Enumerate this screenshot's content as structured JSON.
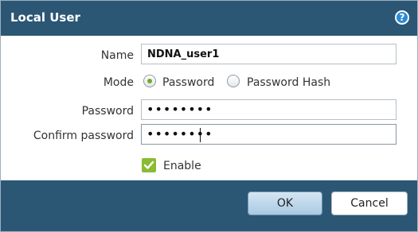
{
  "dialog": {
    "title": "Local User",
    "help_icon_glyph": "?"
  },
  "form": {
    "name_label": "Name",
    "name_value": "NDNA_user1",
    "mode_label": "Mode",
    "mode_options": [
      "Password",
      "Password Hash"
    ],
    "mode_selected": "Password",
    "password_label": "Password",
    "password_masked": "••••••••",
    "confirm_label": "Confirm password",
    "confirm_masked": "••••••••",
    "enable_label": "Enable",
    "enable_checked": true
  },
  "buttons": {
    "ok_label": "OK",
    "cancel_label": "Cancel"
  },
  "colors": {
    "titlebar": "#2b5775",
    "accent_green": "#7aa825",
    "help_blue": "#2a8ad6"
  }
}
